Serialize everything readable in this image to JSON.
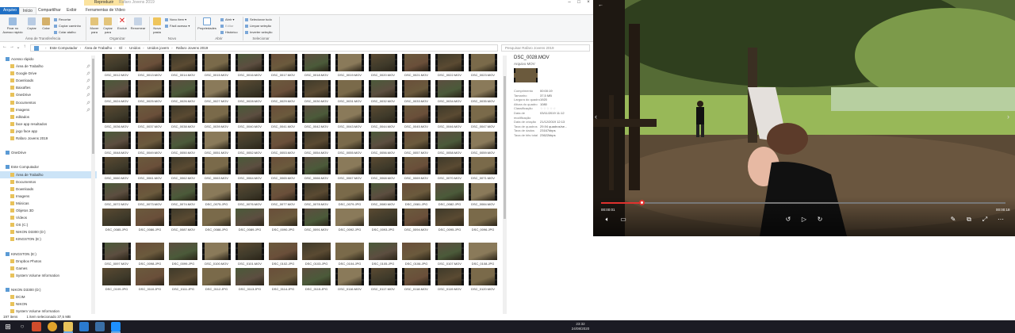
{
  "explorer": {
    "context_tab": "Reproduzir",
    "window_title": "Rafaro Jovens 2019",
    "tabs": [
      "Arquivo",
      "Início",
      "Compartilhar",
      "Exibir",
      "Ferramentas de Vídeo"
    ],
    "ribbon": {
      "clipboard": {
        "pin_label": "Fixar no Acesso rápido",
        "copy_label": "Copiar",
        "paste_label": "Colar",
        "cut": "Recortar",
        "copy_path": "Copiar caminho",
        "paste_shortcut": "Colar atalho",
        "group": "Área de Transferência"
      },
      "organize": {
        "move_to": "Mover para",
        "copy_to": "Copiar para",
        "delete": "Excluir",
        "rename": "Renomear",
        "group": "Organizar"
      },
      "new": {
        "new_folder": "Nova pasta",
        "new_item": "Novo item ▾",
        "easy_access": "Fácil acesso ▾",
        "group": "Novo"
      },
      "open": {
        "properties": "Propriedades",
        "open": "Abrir ▾",
        "edit": "Editar",
        "history": "Histórico",
        "group": "Abrir"
      },
      "select": {
        "select_all": "Selecionar tudo",
        "clear_selection": "Limpar seleção",
        "invert_selection": "Inverter seleção",
        "group": "Selecionar"
      }
    },
    "address": [
      "Este Computador",
      "Área de Trabalho",
      "Gl",
      "Unidos",
      "Unidos jovem",
      "Rafaro Jovens 2019"
    ],
    "search_placeholder": "Pesquisar Rafaro Jovens 2019",
    "nav_items": [
      {
        "label": "Acesso rápido",
        "level": 0,
        "pin": false,
        "selected": false
      },
      {
        "label": "Área de Trabalho",
        "level": 1,
        "pin": true,
        "selected": false
      },
      {
        "label": "Google Drive",
        "level": 1,
        "pin": true,
        "selected": false
      },
      {
        "label": "Downloads",
        "level": 1,
        "pin": true,
        "selected": false
      },
      {
        "label": "Baixaftes",
        "level": 1,
        "pin": true,
        "selected": false
      },
      {
        "label": "OneDrive",
        "level": 1,
        "pin": true,
        "selected": false
      },
      {
        "label": "Documentos",
        "level": 1,
        "pin": true,
        "selected": false
      },
      {
        "label": "Imagens",
        "level": 1,
        "pin": true,
        "selected": false
      },
      {
        "label": "editados",
        "level": 1,
        "pin": false,
        "selected": false
      },
      {
        "label": "face app resultados",
        "level": 1,
        "pin": false,
        "selected": false
      },
      {
        "label": "jogo face app",
        "level": 1,
        "pin": false,
        "selected": false
      },
      {
        "label": "Rafaro Jovens 2019",
        "level": 1,
        "pin": false,
        "selected": false
      },
      {
        "label": "",
        "level": 1,
        "pin": false,
        "selected": false
      },
      {
        "label": "OneDrive",
        "level": 0,
        "pin": false,
        "selected": false
      },
      {
        "label": "",
        "level": 1,
        "pin": false,
        "selected": false
      },
      {
        "label": "Este Computador",
        "level": 0,
        "pin": false,
        "selected": false
      },
      {
        "label": "Área de Trabalho",
        "level": 1,
        "pin": false,
        "selected": true
      },
      {
        "label": "Documentos",
        "level": 1,
        "pin": false,
        "selected": false
      },
      {
        "label": "Downloads",
        "level": 1,
        "pin": false,
        "selected": false
      },
      {
        "label": "Imagens",
        "level": 1,
        "pin": false,
        "selected": false
      },
      {
        "label": "Músicas",
        "level": 1,
        "pin": false,
        "selected": false
      },
      {
        "label": "Objetos 3D",
        "level": 1,
        "pin": false,
        "selected": false
      },
      {
        "label": "Vídeos",
        "level": 1,
        "pin": false,
        "selected": false
      },
      {
        "label": "OS (C:)",
        "level": 1,
        "pin": false,
        "selected": false
      },
      {
        "label": "NIKON D3300 (D:)",
        "level": 1,
        "pin": false,
        "selected": false
      },
      {
        "label": "KINGSTON (E:)",
        "level": 1,
        "pin": false,
        "selected": false
      },
      {
        "label": "",
        "level": 1,
        "pin": false,
        "selected": false
      },
      {
        "label": "KINGSTON (E:)",
        "level": 0,
        "pin": false,
        "selected": false
      },
      {
        "label": "Dropbox Photos",
        "level": 1,
        "pin": false,
        "selected": false
      },
      {
        "label": "Games",
        "level": 1,
        "pin": false,
        "selected": false
      },
      {
        "label": "System Volume Information",
        "level": 1,
        "pin": false,
        "selected": false
      },
      {
        "label": "",
        "level": 1,
        "pin": false,
        "selected": false
      },
      {
        "label": "NIKON D3300 (D:)",
        "level": 0,
        "pin": false,
        "selected": false
      },
      {
        "label": "DCIM",
        "level": 1,
        "pin": false,
        "selected": false
      },
      {
        "label": "NIKON",
        "level": 1,
        "pin": false,
        "selected": false
      },
      {
        "label": "System Volume Information",
        "level": 1,
        "pin": false,
        "selected": false
      },
      {
        "label": "Rede",
        "level": 0,
        "pin": false,
        "selected": false
      }
    ],
    "files": [
      "DSC_0012.MOV",
      "DSC_0013.MOV",
      "DSC_0014.MOV",
      "DSC_0015.MOV",
      "DSC_0016.MOV",
      "DSC_0017.MOV",
      "DSC_0018.MOV",
      "DSC_0019.MOV",
      "DSC_0020.MOV",
      "DSC_0021.MOV",
      "DSC_0022.MOV",
      "DSC_0023.MOV",
      "DSC_0024.MOV",
      "DSC_0025.MOV",
      "DSC_0026.MOV",
      "DSC_0027.MOV",
      "DSC_0028.MOV",
      "DSC_0029.MOV",
      "DSC_0030.MOV",
      "DSC_0031.MOV",
      "DSC_0032.MOV",
      "DSC_0033.MOV",
      "DSC_0034.MOV",
      "DSC_0035.MOV",
      "DSC_0036.MOV",
      "DSC_0037.MOV",
      "DSC_0038.MOV",
      "DSC_0039.MOV",
      "DSC_0040.MOV",
      "DSC_0041.MOV",
      "DSC_0042.MOV",
      "DSC_0043.MOV",
      "DSC_0044.MOV",
      "DSC_0045.MOV",
      "DSC_0046.MOV",
      "DSC_0047.MOV",
      "DSC_0048.MOV",
      "DSC_0049.MOV",
      "DSC_0050.MOV",
      "DSC_0051.MOV",
      "DSC_0052.MOV",
      "DSC_0053.MOV",
      "DSC_0054.MOV",
      "DSC_0055.MOV",
      "DSC_0056.MOV",
      "DSC_0057.MOV",
      "DSC_0058.MOV",
      "DSC_0059.MOV",
      "DSC_0060.MOV",
      "DSC_0061.MOV",
      "DSC_0062.MOV",
      "DSC_0063.MOV",
      "DSC_0064.MOV",
      "DSC_0065.MOV",
      "DSC_0066.MOV",
      "DSC_0067.MOV",
      "DSC_0068.MOV",
      "DSC_0069.MOV",
      "DSC_0070.MOV",
      "DSC_0071.MOV",
      "DSC_0072.MOV",
      "DSC_0073.MOV",
      "DSC_0074.MOV",
      "DSC_0075.JPG",
      "DSC_0076.MOV",
      "DSC_0077.MOV",
      "DSC_0078.MOV",
      "DSC_0079.JPG",
      "DSC_0080.MOV",
      "DSC_0081.JPG",
      "DSC_0082.JPG",
      "DSC_0084.MOV",
      "DSC_0085.JPG",
      "DSC_0086.JPG",
      "DSC_0087.MOV",
      "DSC_0088.JPG",
      "DSC_0089.JPG",
      "DSC_0090.JPG",
      "DSC_0091.MOV",
      "DSC_0092.JPG",
      "DSC_0093.JPG",
      "DSC_0094.MOV",
      "DSC_0095.JPG",
      "DSC_0096.JPG",
      "DSC_0097.MOV",
      "DSC_0098.JPG",
      "DSC_0099.JPG",
      "DSC_0100.MOV",
      "DSC_0101.MOV",
      "DSC_0102.JPG",
      "DSC_0103.JPG",
      "DSC_0104.JPG",
      "DSC_0105.JPG",
      "DSC_0106.JPG",
      "DSC_0107.MOV",
      "DSC_0108.JPG",
      "DSC_0109.JPG",
      "DSC_0110.JPG",
      "DSC_0111.JPG",
      "DSC_0112.JPG",
      "DSC_0113.JPG",
      "DSC_0114.JPG",
      "DSC_0115.JPG",
      "DSC_0116.MOV",
      "DSC_0117.MOV",
      "DSC_0118.MOV",
      "DSC_0119.MOV",
      "DSC_0120.MOV"
    ],
    "details": {
      "name": "DSC_0028.MOV",
      "type": "Arquivo MOV",
      "props": [
        {
          "k": "Comprimento",
          "v": "00:00:19"
        },
        {
          "k": "Tamanho",
          "v": "37,5 MB"
        },
        {
          "k": "Largura do quadro",
          "v": "1920"
        },
        {
          "k": "Altura do quadro",
          "v": "1080"
        },
        {
          "k": "Classificação",
          "v": "☆☆☆☆☆"
        },
        {
          "k": "Data de modificação",
          "v": "03/11/2019 11:12"
        },
        {
          "k": "Data de criação",
          "v": "21/12/2019 12:13"
        },
        {
          "k": "Taxa de quadros",
          "v": "29,94 quadros/se..."
        },
        {
          "k": "Taxa de dados",
          "v": "23167kbps"
        },
        {
          "k": "Taxa de bits total",
          "v": "23622kbps"
        }
      ]
    },
    "status": {
      "count": "197 itens",
      "selected": "1 item selecionado 37,5 MB"
    }
  },
  "player": {
    "time_current": "00:00:01",
    "time_total": "00:00:18",
    "progress": 0.1
  },
  "taskbar": {
    "time": "23:32",
    "date": "24/08/2020"
  },
  "colors": {
    "accent": "#1f6fc4",
    "progress": "#e0322e",
    "taskbar": "#1b1b24",
    "selection": "#cce4f7"
  }
}
